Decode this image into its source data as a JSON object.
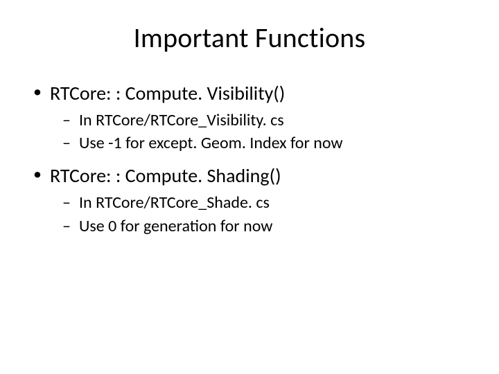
{
  "title": "Important Functions",
  "bullets": [
    {
      "text": "RTCore: : Compute. Visibility()",
      "sub": [
        "In RTCore/RTCore_Visibility. cs",
        "Use -1 for except. Geom. Index for now"
      ]
    },
    {
      "text": "RTCore: : Compute. Shading()",
      "sub": [
        "In RTCore/RTCore_Shade. cs",
        "Use 0 for generation for now"
      ]
    }
  ]
}
